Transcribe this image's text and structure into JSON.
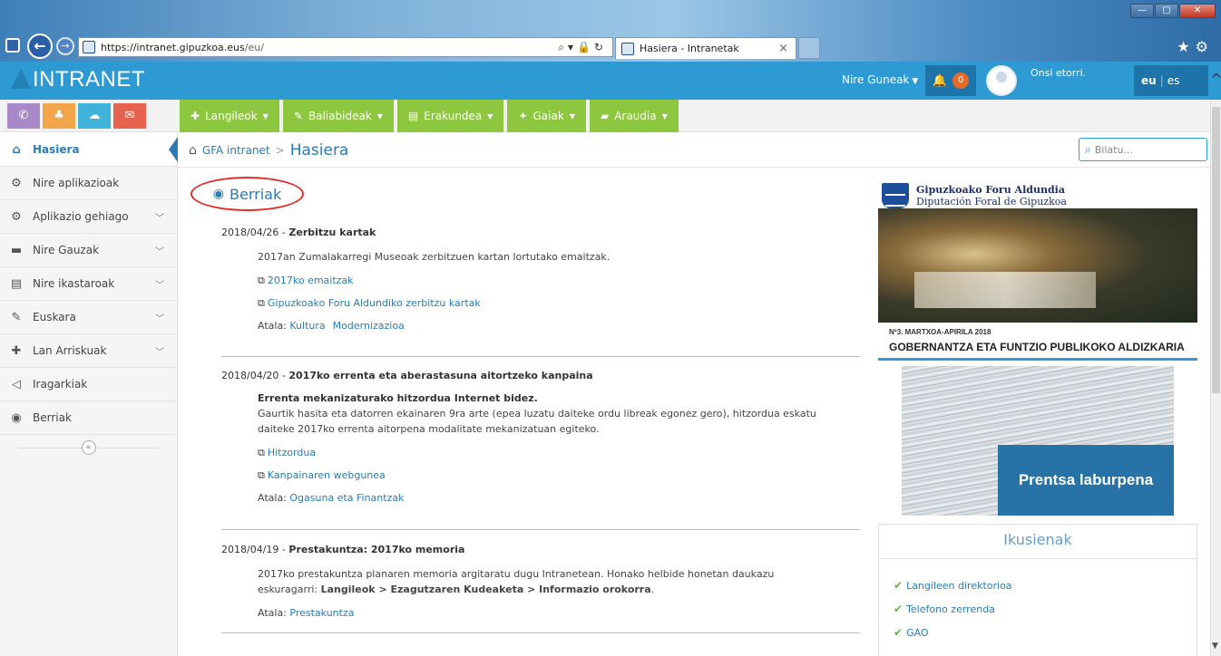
{
  "browser": {
    "url_host": "https://intranet.gipuzkoa.eus",
    "url_path": "/eu/",
    "tab_title": "Hasiera - Intranetak",
    "tab_close": "×",
    "window_controls": [
      "—",
      "▢",
      "✕"
    ],
    "icons": [
      "★",
      "⚙"
    ]
  },
  "header": {
    "logo": "INTRANET",
    "nire_guneak": "Nire Guneak",
    "notification_count": "0",
    "welcome": "Onsi etorri.",
    "lang_eu": "eu",
    "lang_es": "es"
  },
  "quick_buttons": [
    "✆",
    "♣",
    "☁",
    "✉"
  ],
  "menu": [
    {
      "icon": "✚",
      "label": "Langileok"
    },
    {
      "icon": "✎",
      "label": "Baliabideak"
    },
    {
      "icon": "▤",
      "label": "Erakundea"
    },
    {
      "icon": "✦",
      "label": "Gaiak"
    },
    {
      "icon": "▰",
      "label": "Araudia"
    }
  ],
  "sidebar": {
    "items": [
      {
        "icon": "⌂",
        "label": "Hasiera",
        "expandable": false
      },
      {
        "icon": "⚙",
        "label": "Nire aplikazioak",
        "expandable": false
      },
      {
        "icon": "⚙",
        "label": "Aplikazio gehiago",
        "expandable": true
      },
      {
        "icon": "▬",
        "label": "Nire Gauzak",
        "expandable": true
      },
      {
        "icon": "▤",
        "label": "Nire ikastaroak",
        "expandable": true
      },
      {
        "icon": "✎",
        "label": "Euskara",
        "expandable": true
      },
      {
        "icon": "✚",
        "label": "Lan Arriskuak",
        "expandable": true
      },
      {
        "icon": "◁",
        "label": "Iragarkiak",
        "expandable": false
      },
      {
        "icon": "◉",
        "label": "Berriak",
        "expandable": false
      }
    ],
    "collapse": "«"
  },
  "breadcrumb": {
    "root": "GFA intranet",
    "separator": ">",
    "current": "Hasiera"
  },
  "search": {
    "placeholder": "Bilatu..."
  },
  "news": {
    "title": "Berriak",
    "items": [
      {
        "date": "2018/04/26",
        "title": "Zerbitzu kartak",
        "text": "2017an Zumalakarregi Museoak zerbitzuen kartan lortutako emaitzak.",
        "links": [
          "2017ko emaitzak",
          "Gipuzkoako Foru Aldundiko zerbitzu kartak"
        ],
        "atala_label": "Atala:",
        "tags": [
          "Kultura",
          "Modernizazioa"
        ]
      },
      {
        "date": "2018/04/20",
        "title": "2017ko errenta eta aberastasuna aitortzeko kanpaina",
        "lead": "Errenta mekanizaturako hitzordua Internet bidez.",
        "text": "Gaurtik hasita eta datorren ekainaren 9ra arte (epea luzatu daiteke ordu libreak egonez gero), hitzordua eskatu daiteke 2017ko errenta aitorpena modalitate mekanizatuan egiteko.",
        "links": [
          "Hitzordua",
          "Kanpainaren webgunea"
        ],
        "atala_label": "Atala:",
        "tags": [
          "Ogasuna eta Finantzak"
        ]
      },
      {
        "date": "2018/04/19",
        "title": "Prestakuntza: 2017ko memoria",
        "text_before": "2017ko prestakuntza planaren memoria argitaratu dugu Intranetean. Honako helbide honetan daukazu eskuragarri: ",
        "text_bold": "Langileok > Ezagutzaren Kudeaketa > Informazio orokorra",
        "text_after": ".",
        "atala_label": "Atala:",
        "tags": [
          "Prestakuntza"
        ]
      }
    ],
    "separator": "-"
  },
  "rightcol": {
    "gfa_eu": "Gipuzkoako Foru Aldundia",
    "gfa_es": "Diputación Foral de Gipuzkoa",
    "magazine_issue": "Nº3. MARTXOA-APIRILA 2018",
    "magazine_title": "GOBERNANTZA ETA FUNTZIO PUBLIKOKO ALDIZKARIA",
    "prentsa": "Prentsa laburpena",
    "ikusienak_title": "Ikusienak",
    "ikusienak_items": [
      "Langileen direktorioa",
      "Telefono zerrenda",
      "GAO"
    ]
  }
}
